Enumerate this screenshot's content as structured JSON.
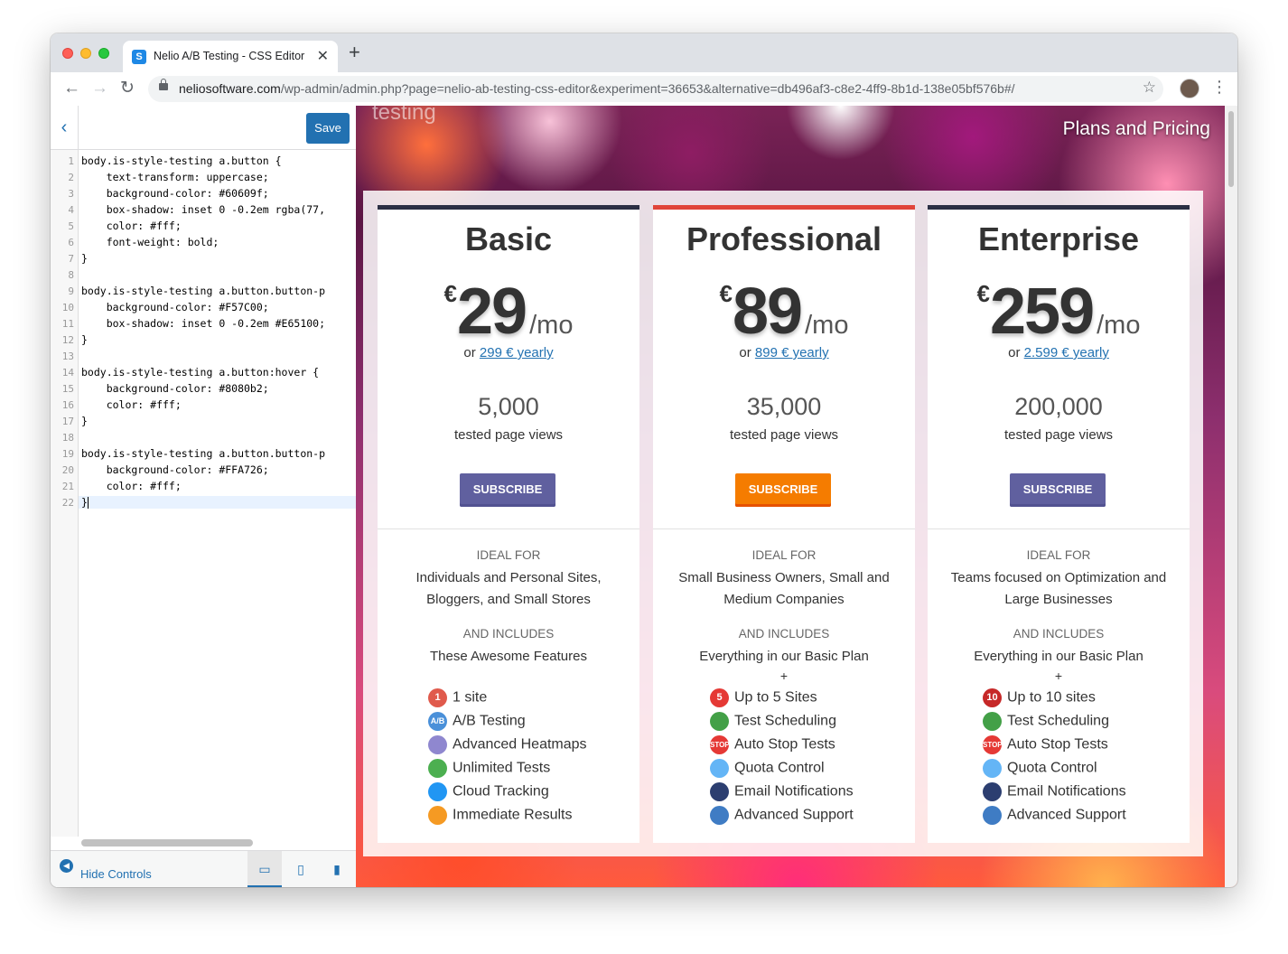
{
  "browser": {
    "tab_title": "Nelio A/B Testing - CSS Editor",
    "url_host": "neliosoftware.com",
    "url_path": "/wp-admin/admin.php?page=nelio-ab-testing-css-editor&experiment=36653&alternative=db496af3-c8e2-4ff9-8b1d-138e05bf576b#/"
  },
  "editor": {
    "save_label": "Save",
    "hide_controls_label": "Hide Controls",
    "code_lines": [
      "body.is-style-testing a.button {",
      "    text-transform: uppercase;",
      "    background-color: #60609f;",
      "    box-shadow: inset 0 -0.2em rgba(77,",
      "    color: #fff;",
      "    font-weight: bold;",
      "}",
      "",
      "body.is-style-testing a.button.button-p",
      "    background-color: #F57C00;",
      "    box-shadow: inset 0 -0.2em #E65100;",
      "}",
      "",
      "body.is-style-testing a.button:hover {",
      "    background-color: #8080b2;",
      "    color: #fff;",
      "}",
      "",
      "body.is-style-testing a.button.button-p",
      "    background-color: #FFA726;",
      "    color: #fff;",
      "}"
    ]
  },
  "preview": {
    "brand_text": "testing",
    "page_title": "Plans and Pricing",
    "labels": {
      "ideal_for": "IDEAL FOR",
      "and_includes": "AND INCLUDES",
      "tested_views": "tested page views",
      "subscribe": "SUBSCRIBE",
      "per_month": "/mo",
      "or": "or",
      "plus": "+"
    },
    "plans": [
      {
        "name": "Basic",
        "currency": "€",
        "price": "29",
        "yearly": "299 € yearly",
        "views": "5,000",
        "ideal_line1": "Individuals and Personal Sites,",
        "ideal_line2": "Bloggers, and Small Stores",
        "includes": "These Awesome Features",
        "features": [
          "1 site",
          "A/B Testing",
          "Advanced Heatmaps",
          "Unlimited Tests",
          "Cloud Tracking",
          "Immediate Results"
        ]
      },
      {
        "name": "Professional",
        "currency": "€",
        "price": "89",
        "yearly": "899 € yearly",
        "views": "35,000",
        "ideal_line1": "Small Business Owners, Small and",
        "ideal_line2": "Medium Companies",
        "includes": "Everything in our Basic Plan",
        "features": [
          "Up to 5 Sites",
          "Test Scheduling",
          "Auto Stop Tests",
          "Quota Control",
          "Email Notifications",
          "Advanced Support"
        ]
      },
      {
        "name": "Enterprise",
        "currency": "€",
        "price": "259",
        "yearly": "2.599 € yearly",
        "views": "200,000",
        "ideal_line1": "Teams focused on Optimization and",
        "ideal_line2": "Large Businesses",
        "includes": "Everything in our Basic Plan",
        "features": [
          "Up to 10 sites",
          "Test Scheduling",
          "Auto Stop Tests",
          "Quota Control",
          "Email Notifications",
          "Advanced Support"
        ]
      }
    ],
    "icon_badges": {
      "basic_sites": "1",
      "pro_sites": "5",
      "ent_sites": "10",
      "stop": "STOP",
      "ab": "A/B"
    }
  }
}
